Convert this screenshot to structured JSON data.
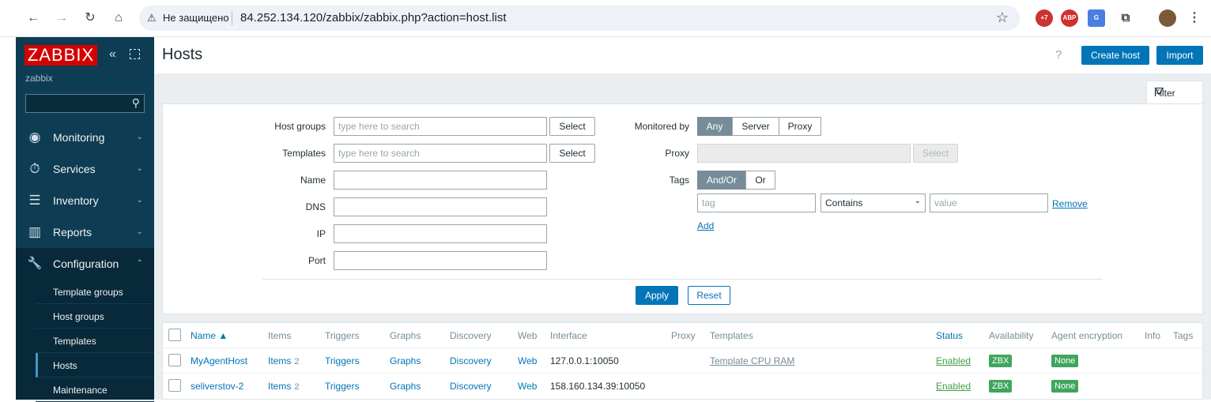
{
  "browser": {
    "security_label": "Не защищено",
    "url": "84.252.134.120/zabbix/zabbix.php?action=host.list",
    "ext_badge": "+7",
    "abp_label": "ABP"
  },
  "sidebar": {
    "logo": "ZABBIX",
    "server_name": "zabbix",
    "menu": [
      {
        "label": "Monitoring",
        "icon": "eye-icon",
        "glyph": "◉"
      },
      {
        "label": "Services",
        "icon": "stopwatch-icon",
        "glyph": "⏱"
      },
      {
        "label": "Inventory",
        "icon": "list-icon",
        "glyph": "☰"
      },
      {
        "label": "Reports",
        "icon": "bar-chart-icon",
        "glyph": "▥"
      },
      {
        "label": "Configuration",
        "icon": "wrench-icon",
        "glyph": "🔧"
      }
    ],
    "submenu": [
      "Template groups",
      "Host groups",
      "Templates",
      "Hosts",
      "Maintenance"
    ]
  },
  "header": {
    "title": "Hosts",
    "help": "?",
    "create_host": "Create host",
    "import": "Import"
  },
  "filter": {
    "tab_label": "Filter",
    "host_groups_label": "Host groups",
    "host_groups_placeholder": "type here to search",
    "templates_label": "Templates",
    "templates_placeholder": "type here to search",
    "select": "Select",
    "name_label": "Name",
    "dns_label": "DNS",
    "ip_label": "IP",
    "port_label": "Port",
    "monitored_by_label": "Monitored by",
    "monitored_by_options": [
      "Any",
      "Server",
      "Proxy"
    ],
    "monitored_by_selected": "Any",
    "proxy_label": "Proxy",
    "tags_label": "Tags",
    "tags_options": [
      "And/Or",
      "Or"
    ],
    "tags_selected": "And/Or",
    "tag_placeholder": "tag",
    "operator_value": "Contains",
    "value_placeholder": "value",
    "remove": "Remove",
    "add": "Add",
    "apply": "Apply",
    "reset": "Reset"
  },
  "table": {
    "headers": {
      "name": "Name ▲",
      "items": "Items",
      "triggers": "Triggers",
      "graphs": "Graphs",
      "discovery": "Discovery",
      "web": "Web",
      "interface": "Interface",
      "proxy": "Proxy",
      "templates": "Templates",
      "status": "Status",
      "availability": "Availability",
      "agent_encryption": "Agent encryption",
      "info": "Info",
      "tags": "Tags"
    },
    "rows": [
      {
        "name": "MyAgentHost",
        "items": "Items",
        "items_count": "2",
        "triggers": "Triggers",
        "graphs": "Graphs",
        "discovery": "Discovery",
        "web": "Web",
        "interface": "127.0.0.1:10050",
        "templates": "Template CPU RAM",
        "status": "Enabled",
        "availability": "ZBX",
        "encryption": "None"
      },
      {
        "name": "seliverstov-2",
        "items": "Items",
        "items_count": "2",
        "triggers": "Triggers",
        "graphs": "Graphs",
        "discovery": "Discovery",
        "web": "Web",
        "interface": "158.160.134.39:10050",
        "templates": "",
        "status": "Enabled",
        "availability": "ZBX",
        "encryption": "None"
      }
    ]
  },
  "colors": {
    "sidebar_bg": "#0e3c53",
    "accent_blue": "#0275b8",
    "logo_red": "#d40000",
    "status_green": "#429e47",
    "badge_green": "#3fa65d"
  }
}
